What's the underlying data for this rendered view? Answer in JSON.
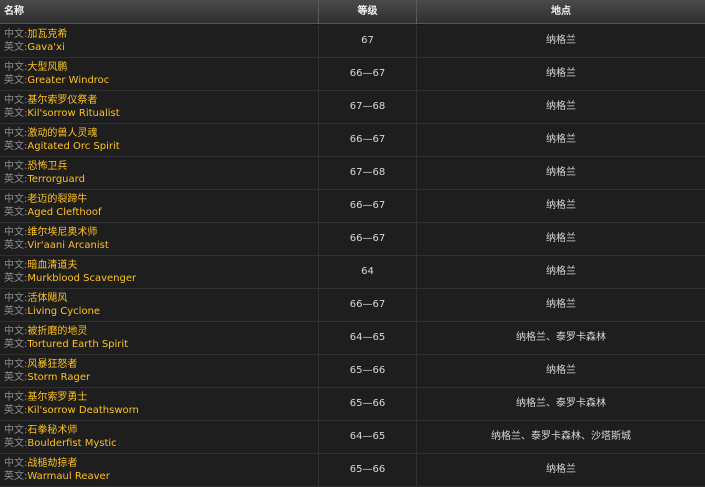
{
  "header": {
    "name": "名称",
    "level": "等级",
    "location": "地点"
  },
  "labels": {
    "cn": "中文:",
    "en": "英文:"
  },
  "rows": [
    {
      "cn": "加瓦克希",
      "en": "Gava'xi",
      "level": "67",
      "location": "纳格兰"
    },
    {
      "cn": "大型风鹏",
      "en": "Greater Windroc",
      "level": "66—67",
      "location": "纳格兰"
    },
    {
      "cn": "基尔索罗仪祭者",
      "en": "Kil'sorrow Ritualist",
      "level": "67—68",
      "location": "纳格兰"
    },
    {
      "cn": "激动的兽人灵魂",
      "en": "Agitated Orc Spirit",
      "level": "66—67",
      "location": "纳格兰"
    },
    {
      "cn": "恐怖卫兵",
      "en": "Terrorguard",
      "level": "67—68",
      "location": "纳格兰"
    },
    {
      "cn": "老迈的裂蹄牛",
      "en": "Aged Clefthoof",
      "level": "66—67",
      "location": "纳格兰"
    },
    {
      "cn": "维尔埃尼奥术师",
      "en": "Vir'aani Arcanist",
      "level": "66—67",
      "location": "纳格兰"
    },
    {
      "cn": "暗血清道夫",
      "en": "Murkblood Scavenger",
      "level": "64",
      "location": "纳格兰"
    },
    {
      "cn": "活体飓风",
      "en": "Living Cyclone",
      "level": "66—67",
      "location": "纳格兰"
    },
    {
      "cn": "被折磨的地灵",
      "en": "Tortured Earth Spirit",
      "level": "64—65",
      "location": "纳格兰、泰罗卡森林"
    },
    {
      "cn": "风暴狂怒者",
      "en": "Storm Rager",
      "level": "65—66",
      "location": "纳格兰"
    },
    {
      "cn": "基尔索罗勇士",
      "en": "Kil'sorrow Deathsworn",
      "level": "65—66",
      "location": "纳格兰、泰罗卡森林"
    },
    {
      "cn": "石拳秘术师",
      "en": "Boulderfist Mystic",
      "level": "64—65",
      "location": "纳格兰、泰罗卡森林、沙塔斯城"
    },
    {
      "cn": "战槌劫掠者",
      "en": "Warmaul Reaver",
      "level": "65—66",
      "location": "纳格兰"
    }
  ]
}
